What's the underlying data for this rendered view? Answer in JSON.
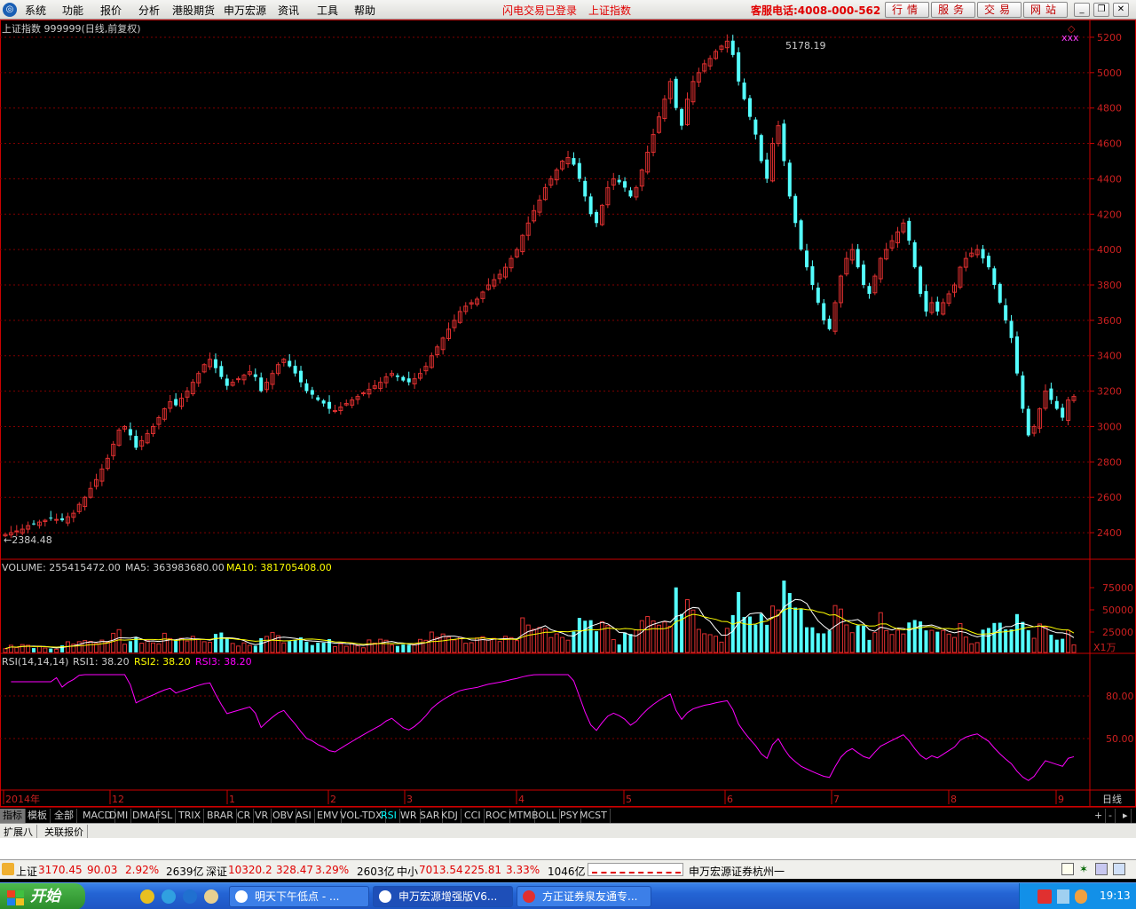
{
  "menu": {
    "items": [
      "系统",
      "功能",
      "报价",
      "分析",
      "港股期货",
      "申万宏源",
      "资讯",
      "工具",
      "帮助"
    ],
    "status1": "闪电交易已登录",
    "status2": "上证指数",
    "service": "客服电话:4008-000-562",
    "buttons": [
      "行情",
      "服务",
      "交易",
      "网站"
    ]
  },
  "chart_data": [
    {
      "type": "candlestick",
      "title": "上证指数 999999(日线,前复权)",
      "high_label": "5178.19",
      "low_label": "2384.48",
      "ylim": [
        2300,
        5250
      ],
      "yticks": [
        2400,
        2600,
        2800,
        3000,
        3200,
        3400,
        3600,
        3800,
        4000,
        4200,
        4400,
        4600,
        4800,
        5000,
        5200
      ],
      "closes": [
        2390,
        2400,
        2410,
        2420,
        2440,
        2450,
        2460,
        2470,
        2480,
        2475,
        2470,
        2490,
        2510,
        2560,
        2600,
        2650,
        2700,
        2760,
        2820,
        2900,
        2980,
        3000,
        2950,
        2880,
        2920,
        2960,
        3000,
        3050,
        3100,
        3140,
        3120,
        3160,
        3200,
        3250,
        3300,
        3350,
        3380,
        3330,
        3280,
        3230,
        3250,
        3270,
        3290,
        3310,
        3280,
        3200,
        3250,
        3300,
        3350,
        3380,
        3340,
        3300,
        3250,
        3200,
        3180,
        3150,
        3130,
        3100,
        3090,
        3110,
        3130,
        3150,
        3170,
        3190,
        3210,
        3230,
        3250,
        3280,
        3300,
        3280,
        3260,
        3250,
        3270,
        3300,
        3340,
        3400,
        3450,
        3500,
        3550,
        3600,
        3650,
        3680,
        3700,
        3720,
        3760,
        3800,
        3830,
        3860,
        3900,
        3950,
        4000,
        4080,
        4150,
        4220,
        4280,
        4350,
        4400,
        4450,
        4500,
        4520,
        4480,
        4400,
        4300,
        4200,
        4150,
        4250,
        4350,
        4400,
        4380,
        4350,
        4300,
        4350,
        4450,
        4550,
        4650,
        4750,
        4850,
        4950,
        4800,
        4700,
        4850,
        4950,
        5000,
        5050,
        5080,
        5120,
        5150,
        5178,
        5100,
        4950,
        4850,
        4750,
        4650,
        4500,
        4400,
        4600,
        4700,
        4500,
        4300,
        4150,
        4000,
        3900,
        3800,
        3700,
        3600,
        3550,
        3700,
        3850,
        3950,
        4000,
        3900,
        3800,
        3750,
        3850,
        3950,
        4000,
        4050,
        4100,
        4150,
        4050,
        3900,
        3750,
        3650,
        3700,
        3650,
        3700,
        3750,
        3800,
        3900,
        3950,
        3980,
        4000,
        3950,
        3900,
        3800,
        3700,
        3600,
        3500,
        3300,
        3100,
        2950,
        3000,
        3100,
        3200,
        3150,
        3100,
        3050,
        3150,
        3170
      ],
      "volume": {
        "label": "VOLUME: 255415472.00",
        "ma5": "MA5: 363983680.00",
        "ma10": "MA10: 381705408.00",
        "yticks": [
          "75000",
          "50000",
          "25000"
        ],
        "unit": "X1万"
      },
      "rsi": {
        "label": "RSI(14,14,14)",
        "rsi1": "RSI1: 38.20",
        "rsi2": "RSI2: 38.20",
        "rsi3": "RSI3: 38.20",
        "yticks": [
          "80.00",
          "50.00"
        ]
      },
      "xlabels": [
        "2014年",
        "12",
        "1",
        "2",
        "3",
        "4",
        "5",
        "6",
        "7",
        "8",
        "9"
      ],
      "period_label": "日线"
    }
  ],
  "tabs": [
    "指标",
    "模板",
    "全部",
    "MACD",
    "DMI",
    "DMA",
    "FSL",
    "TRIX",
    "BRAR",
    "CR",
    "VR",
    "OBV",
    "ASI",
    "EMV",
    "VOL-TDX",
    "RSI",
    "WR",
    "SAR",
    "KDJ",
    "CCI",
    "ROC",
    "MTM",
    "BOLL",
    "PSY",
    "MCST"
  ],
  "active_tab": "RSI",
  "subtabs": [
    "扩展八",
    "关联报价"
  ],
  "zoom": [
    "+",
    "-"
  ],
  "status": {
    "sh_name": "上证",
    "sh_val": "3170.45",
    "sh_chg": "90.03",
    "sh_pct": "2.92%",
    "sh_amt": "2639亿",
    "sz_name": "深证",
    "sz_val": "10320.2",
    "sz_chg": "328.47",
    "sz_pct": "3.29%",
    "sz_amt": "2603亿",
    "zx_name": "中小",
    "zx_val": "7013.54",
    "zx_chg": "225.81",
    "zx_pct": "3.33%",
    "zx_amt": "1046亿",
    "broker": "申万宏源证券杭州一"
  },
  "taskbar": {
    "start": "开始",
    "tasks": [
      "明天下午低点 - ...",
      "申万宏源增强版V6...",
      "方正证券泉友通专..."
    ],
    "clock": "19:13"
  },
  "colors": {
    "up": "#e03030",
    "down": "#54ffff",
    "grid": "#800000",
    "axis": "#cc0000",
    "ma5": "#ffffff",
    "ma10": "#ffff00",
    "rsi": "#ff00ff"
  }
}
